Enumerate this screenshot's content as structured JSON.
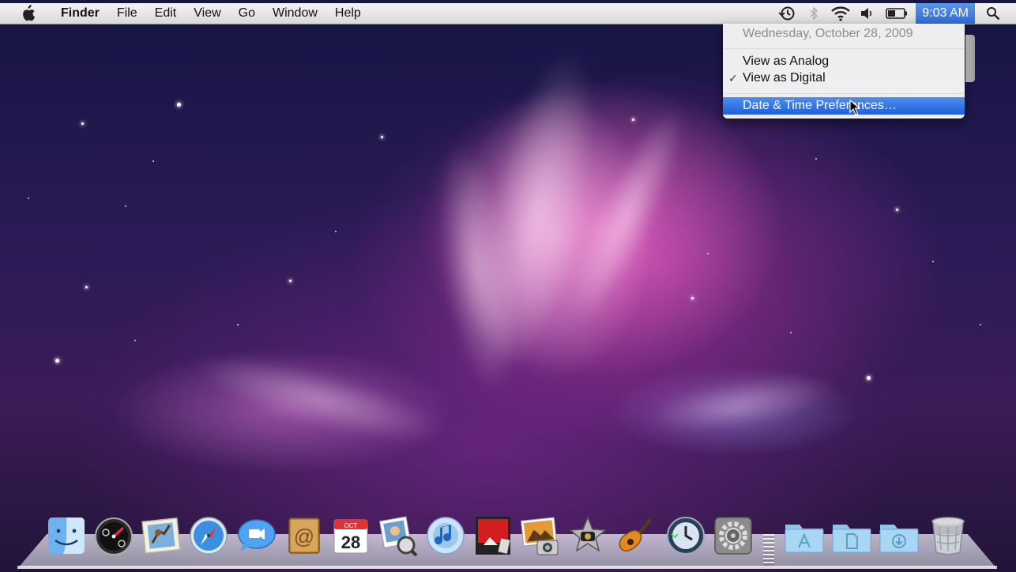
{
  "menubar": {
    "app_menu": "Finder",
    "menus": [
      "File",
      "Edit",
      "View",
      "Go",
      "Window",
      "Help"
    ],
    "clock": "9:03 AM",
    "status_icons": [
      "time-machine-icon",
      "bluetooth-icon",
      "wifi-icon",
      "volume-icon",
      "battery-icon"
    ]
  },
  "clock_menu": {
    "date": "Wednesday, October 28, 2009",
    "items": [
      {
        "label": "View as Analog",
        "checked": false
      },
      {
        "label": "View as Digital",
        "checked": true
      }
    ],
    "preferences": "Date & Time Preferences…",
    "check_mark": "✓"
  },
  "dock": {
    "calendar_month": "OCT",
    "calendar_day": "28",
    "apps": [
      "Finder",
      "Dashboard",
      "Mail",
      "Safari",
      "iChat",
      "Address Book",
      "iCal",
      "Preview",
      "iTunes",
      "Front Row",
      "iPhoto",
      "iMovie",
      "GarageBand",
      "Time Machine",
      "System Preferences",
      "Applications",
      "Documents",
      "Downloads",
      "Trash"
    ]
  },
  "colors": {
    "highlight": "#2e6bd6",
    "menubar": "#e6e6e6",
    "wallpaper_accent": "#e84fc0"
  }
}
